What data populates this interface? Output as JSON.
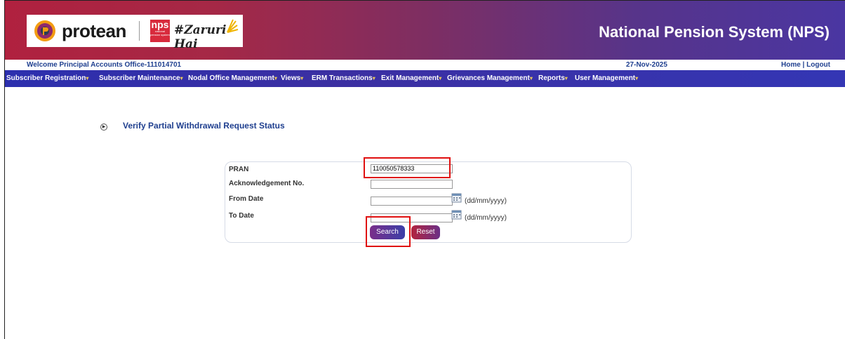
{
  "header": {
    "logo_text": "protean",
    "nps_badge": "nps",
    "nps_badge_sub": "national pension system",
    "tagline": "#Zaruri Hai",
    "app_title": "National Pension System (NPS)"
  },
  "infobar": {
    "welcome": "Welcome Principal Accounts Office-111014701",
    "date": "27-Nov-2025",
    "links": "Home | Logout"
  },
  "menu": [
    {
      "label": "Subscriber Registration"
    },
    {
      "label": "Subscriber Maintenance"
    },
    {
      "label": "Nodal Office Management"
    },
    {
      "label": "Views"
    },
    {
      "label": "ERM Transactions"
    },
    {
      "label": "Exit Management"
    },
    {
      "label": "Grievances Management"
    },
    {
      "label": "Reports"
    },
    {
      "label": "User Management"
    }
  ],
  "page": {
    "title": "Verify Partial Withdrawal Request Status"
  },
  "form": {
    "pran_label": "PRAN",
    "pran_value": "110050578333",
    "ack_label": "Acknowledgement No.",
    "ack_value": "",
    "from_label": "From Date",
    "from_value": "",
    "to_label": "To Date",
    "to_value": "",
    "date_format": "(dd/mm/yyyy)",
    "search_label": "Search",
    "reset_label": "Reset"
  },
  "colors": {
    "header_start": "#b0213f",
    "header_end": "#4a36a2",
    "menubar": "#3436b4",
    "highlight": "#e01010",
    "title_blue": "#1f3f8f"
  }
}
